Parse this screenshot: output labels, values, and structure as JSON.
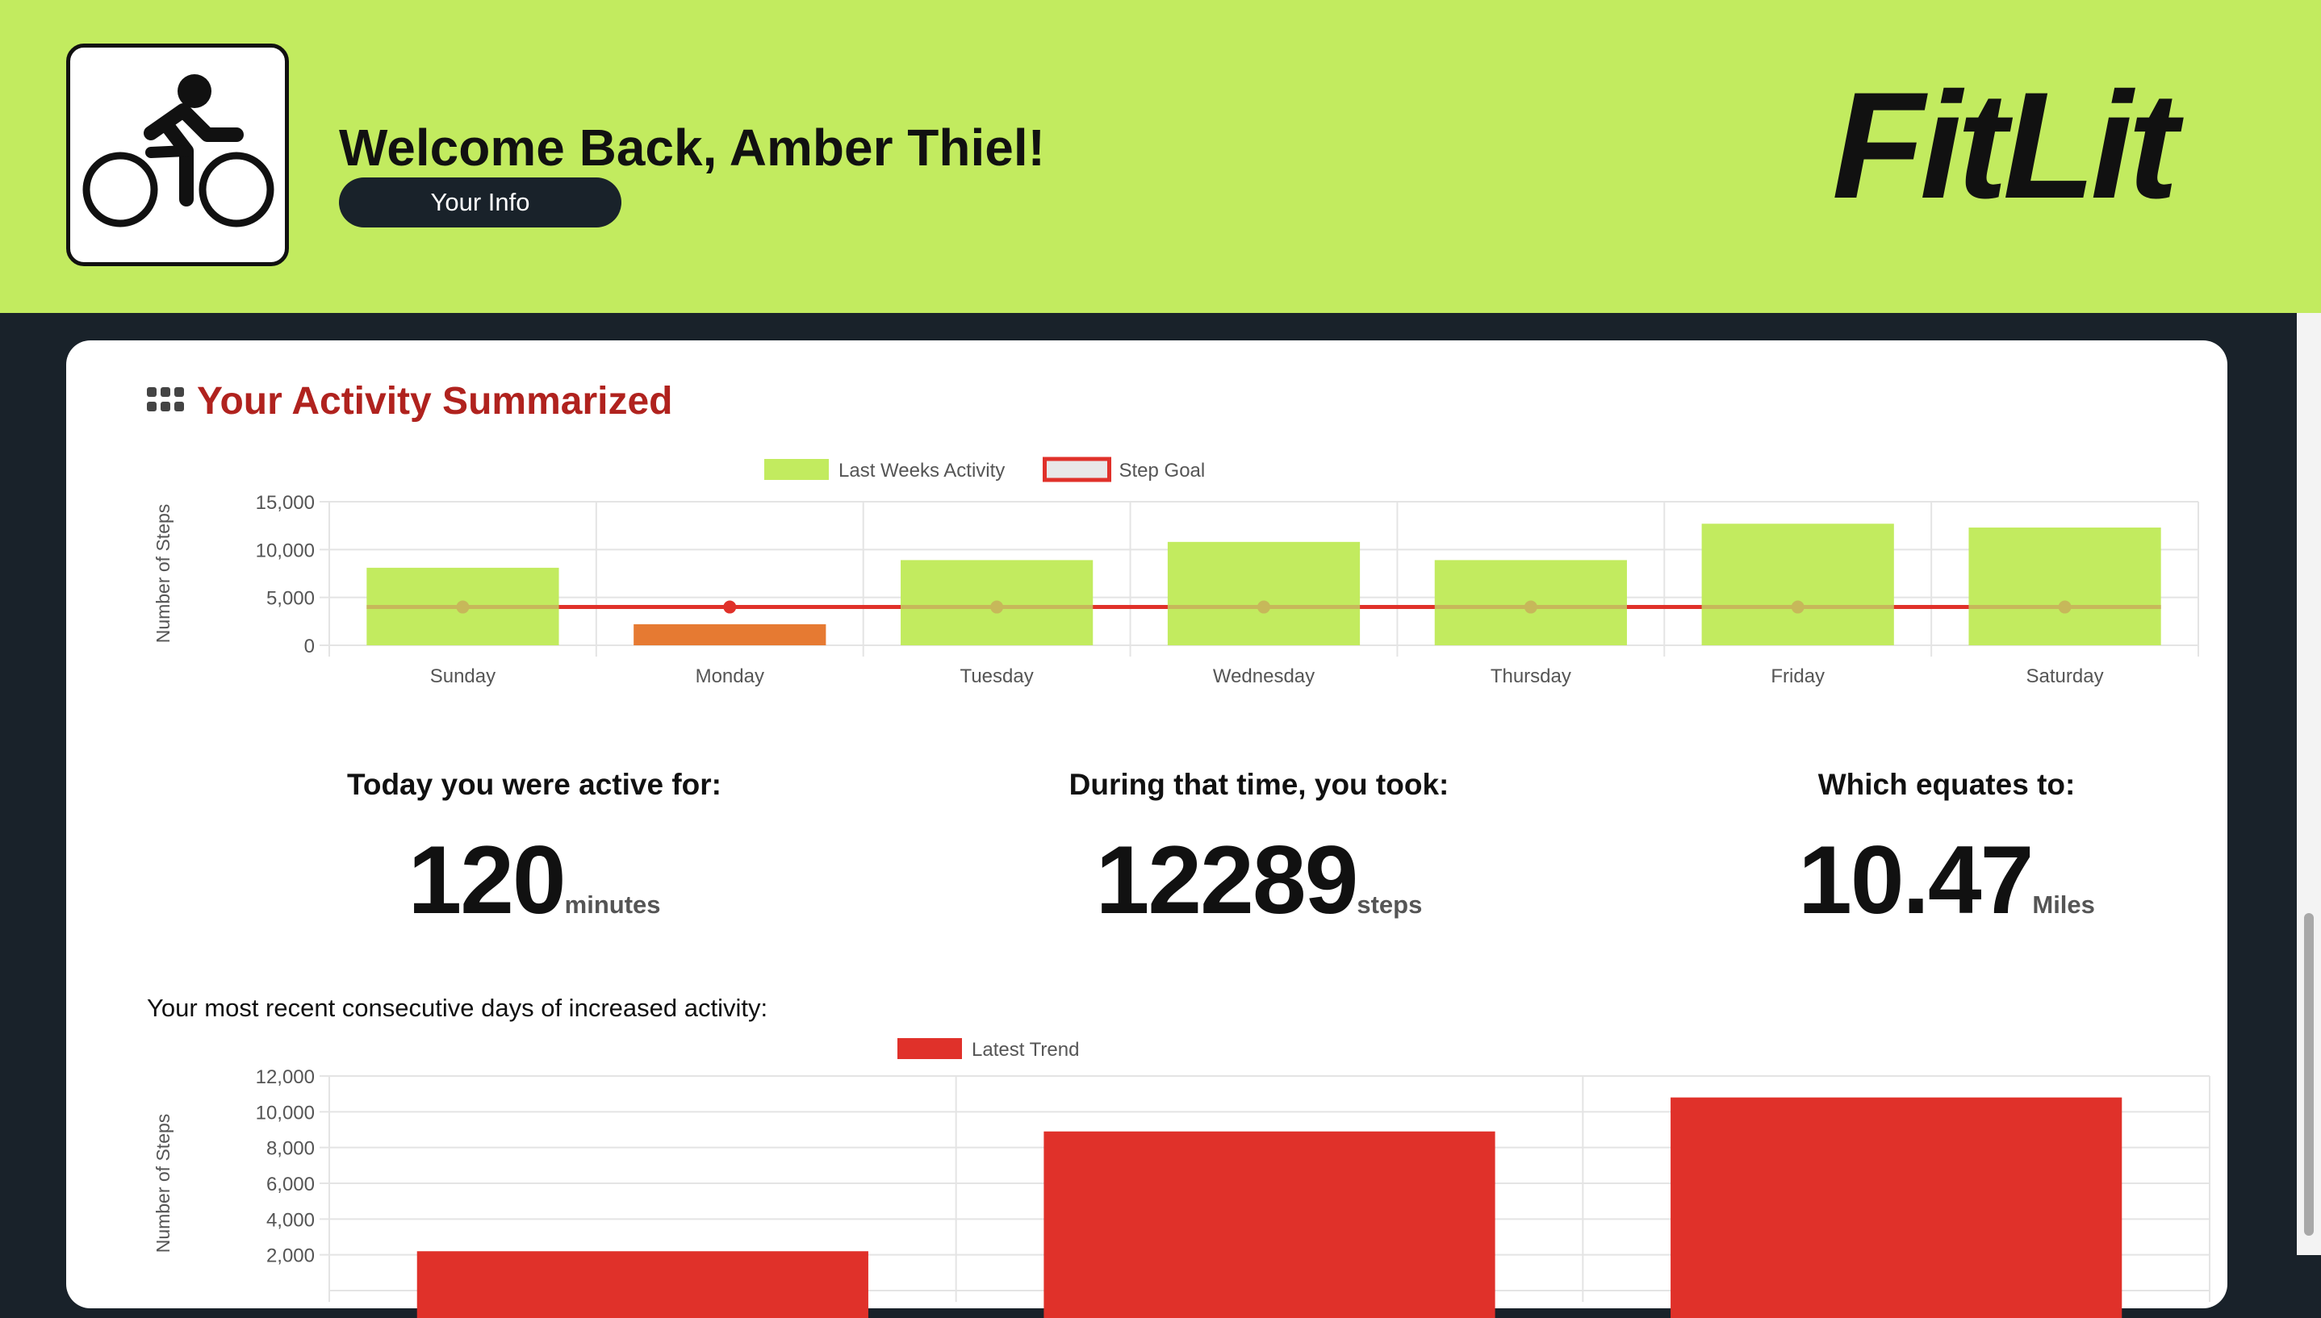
{
  "header": {
    "welcome": "Welcome Back, Amber Thiel!",
    "info_button": "Your Info",
    "brand": "FitLit",
    "logo_icon": "cyclist-icon",
    "background_color": "#c2eb5f"
  },
  "section": {
    "icon": "grid-icon",
    "title": "Your Activity Summarized",
    "title_color": "#b0221e"
  },
  "stats": {
    "active": {
      "label": "Today you were active for:",
      "value": "120",
      "unit": "minutes"
    },
    "steps": {
      "label": "During that time, you took:",
      "value": "12289",
      "unit": "steps"
    },
    "miles": {
      "label": "Which equates to:",
      "value": "10.47",
      "unit": "Miles"
    }
  },
  "consecutive_label": "Your most recent consecutive days of increased activity:",
  "chart_data": [
    {
      "type": "bar",
      "categories": [
        "Sunday",
        "Monday",
        "Tuesday",
        "Wednesday",
        "Thursday",
        "Friday",
        "Saturday"
      ],
      "series": [
        {
          "name": "Last Weeks Activity",
          "type": "bar",
          "values": [
            8100,
            2200,
            8900,
            10800,
            8900,
            12700,
            12300
          ],
          "color": "#c2eb5f",
          "below_goal_color": "#e67a32"
        },
        {
          "name": "Step Goal",
          "type": "line",
          "values": [
            4000,
            4000,
            4000,
            4000,
            4000,
            4000,
            4000
          ],
          "color": "#e0312a"
        }
      ],
      "ylabel": "Number of Steps",
      "ylim": [
        0,
        15000
      ],
      "yticks": [
        0,
        5000,
        10000,
        15000
      ],
      "ytick_labels": [
        "0",
        "5,000",
        "10,000",
        "15,000"
      ],
      "grid": true,
      "legend": "top-center"
    },
    {
      "type": "bar",
      "categories": [
        "",
        "",
        ""
      ],
      "series": [
        {
          "name": "Latest Trend",
          "values": [
            2200,
            8900,
            10800
          ],
          "color": "#e0312a"
        }
      ],
      "ylabel": "Number of Steps",
      "ylim": [
        0,
        12000
      ],
      "yticks": [
        2000,
        4000,
        6000,
        8000,
        10000,
        12000
      ],
      "ytick_labels": [
        "2,000",
        "4,000",
        "6,000",
        "8,000",
        "10,000",
        "12,000"
      ],
      "grid": true,
      "legend": "top-center"
    }
  ]
}
